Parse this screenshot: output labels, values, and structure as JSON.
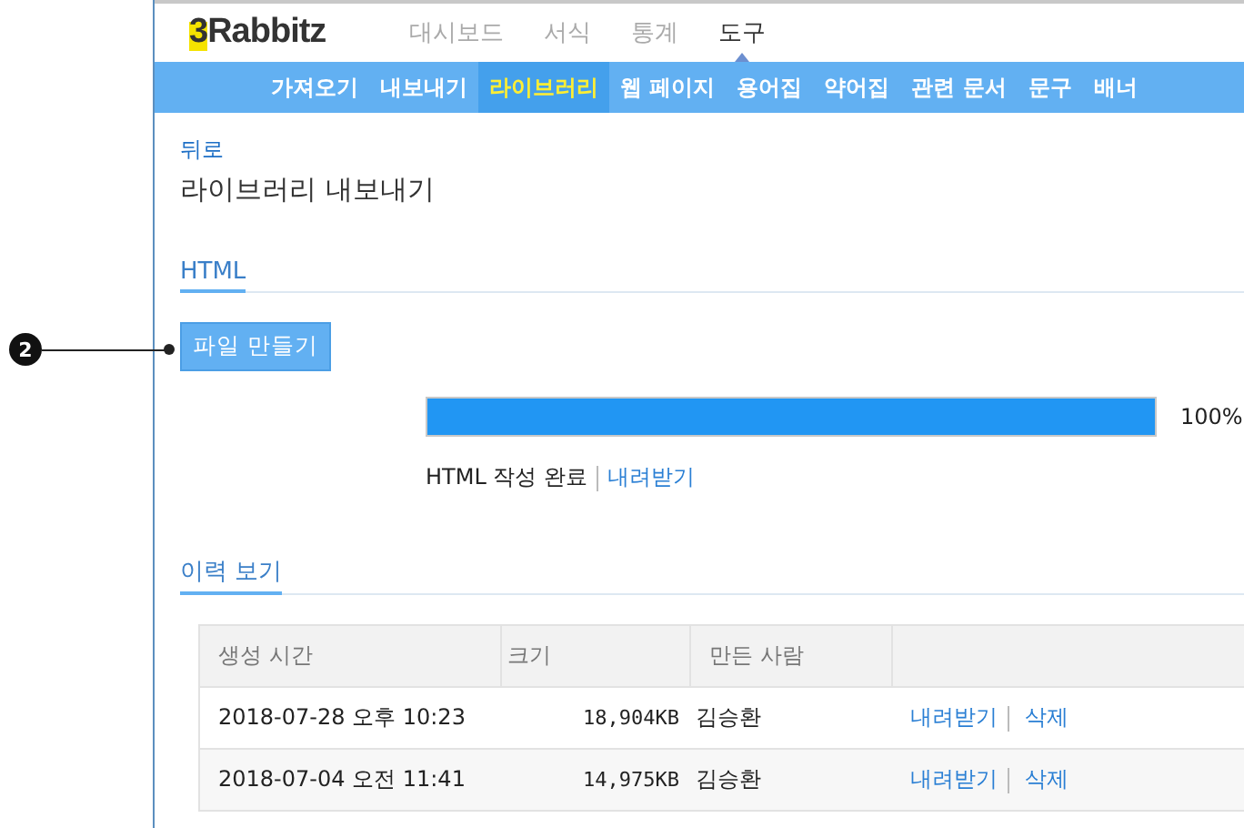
{
  "logo": {
    "mark": "3",
    "text": "Rabbitz"
  },
  "main_nav": [
    {
      "label": "대시보드",
      "selected": false
    },
    {
      "label": "서식",
      "selected": false
    },
    {
      "label": "통계",
      "selected": false
    },
    {
      "label": "도구",
      "selected": true
    }
  ],
  "sub_nav": [
    {
      "label": "가져오기",
      "selected": false
    },
    {
      "label": "내보내기",
      "selected": false
    },
    {
      "label": "라이브러리",
      "selected": true
    },
    {
      "label": "웹 페이지",
      "selected": false
    },
    {
      "label": "용어집",
      "selected": false
    },
    {
      "label": "약어집",
      "selected": false
    },
    {
      "label": "관련 문서",
      "selected": false
    },
    {
      "label": "문구",
      "selected": false
    },
    {
      "label": "배너",
      "selected": false
    }
  ],
  "back_link": "뒤로",
  "page_title": "라이브러리 내보내기",
  "html_section": {
    "tab": "HTML",
    "button": "파일 만들기",
    "progress": {
      "level": 1,
      "reading": "100%"
    },
    "status": "HTML 작성 완료",
    "download": "내려받기"
  },
  "history": {
    "tab": "이력 보기",
    "columns": [
      "생성 시간",
      "크기",
      "만든 사람"
    ],
    "rows": [
      {
        "created": "2018-07-28 오후 10:23",
        "size": "18,904KB",
        "author": "김승환",
        "actions": [
          "내려받기",
          "삭제"
        ]
      },
      {
        "created": "2018-07-04 오전 11:41",
        "size": "14,975KB",
        "author": "김승환",
        "actions": [
          "내려받기",
          "삭제"
        ]
      }
    ]
  },
  "callout": {
    "number": "2"
  }
}
